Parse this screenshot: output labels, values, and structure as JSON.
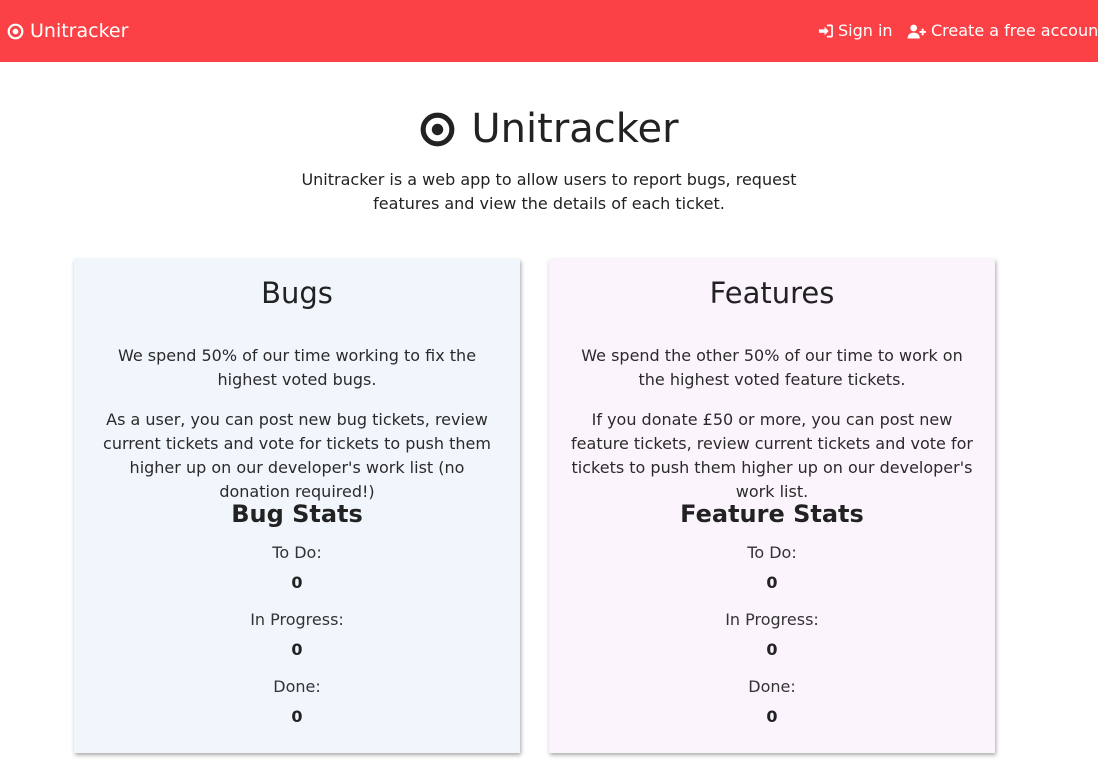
{
  "navbar": {
    "brand": "Unitracker",
    "brand_icon": "bullseye-icon",
    "sign_in": "Sign in",
    "sign_in_icon": "sign-in-icon",
    "create_account": "Create a free account",
    "create_account_icon": "user-plus-icon",
    "background_color": "#fc4146"
  },
  "hero": {
    "title": "Unitracker",
    "icon": "bullseye-icon",
    "description": "Unitracker is a web app to allow users to report bugs, request features and view the details of each ticket."
  },
  "bugs": {
    "title": "Bugs",
    "paragraph1": "We spend 50% of our time working to fix the highest voted bugs.",
    "paragraph2": "As a user, you can post new bug tickets, review current tickets and vote for tickets to push them higher up on our developer's work list (no donation required!)",
    "stats_title": "Bug Stats",
    "stats": [
      {
        "label": "To Do:",
        "value": "0"
      },
      {
        "label": "In Progress:",
        "value": "0"
      },
      {
        "label": "Done:",
        "value": "0"
      }
    ],
    "background_color": "#f1f6fc"
  },
  "features": {
    "title": "Features",
    "paragraph1": "We spend the other 50% of our time to work on the highest voted feature tickets.",
    "paragraph2": "If you donate £50 or more, you can post new feature tickets, review current tickets and vote for tickets to push them higher up on our developer's work list.",
    "stats_title": "Feature Stats",
    "stats": [
      {
        "label": "To Do:",
        "value": "0"
      },
      {
        "label": "In Progress:",
        "value": "0"
      },
      {
        "label": "Done:",
        "value": "0"
      }
    ],
    "background_color": "#fcf4fd"
  }
}
